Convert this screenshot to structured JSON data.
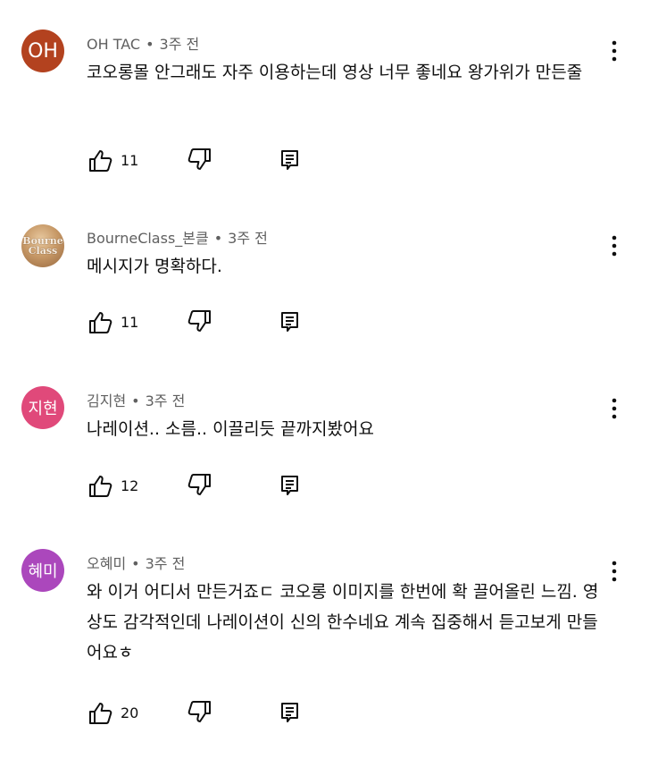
{
  "comments": [
    {
      "author": "OH TAC",
      "time": "3주 전",
      "avatar_text": "OH",
      "avatar_color": "#b3421f",
      "text": "코오롱몰 안그래도 자주 이용하는데 영상 너무 좋네요 왕가위가 만든줄",
      "likes": "11"
    },
    {
      "author": "BourneClass_본클",
      "time": "3주 전",
      "avatar_text": [
        "Bourne",
        "Class"
      ],
      "text": "메시지가 명확하다.",
      "likes": "11"
    },
    {
      "author": "김지현",
      "time": "3주 전",
      "avatar_text": "지현",
      "avatar_color": "#e0497a",
      "text": "나레이션.. 소름.. 이끌리듯 끝까지봤어요",
      "likes": "12"
    },
    {
      "author": "오혜미",
      "time": "3주 전",
      "avatar_text": "혜미",
      "avatar_color": "#ab47bc",
      "text": "와 이거 어디서 만든거죠ㄷ 코오롱 이미지를 한번에 확 끌어올린 느낌. 영상도 감각적인데 나레이션이 신의 한수네요 계속 집중해서 듣고보게 만들어요ㅎ",
      "likes": "20"
    }
  ],
  "icons": {
    "like": "thumbs-up-icon",
    "dislike": "thumbs-down-icon",
    "reply": "reply-icon",
    "menu": "more-vert-icon"
  }
}
